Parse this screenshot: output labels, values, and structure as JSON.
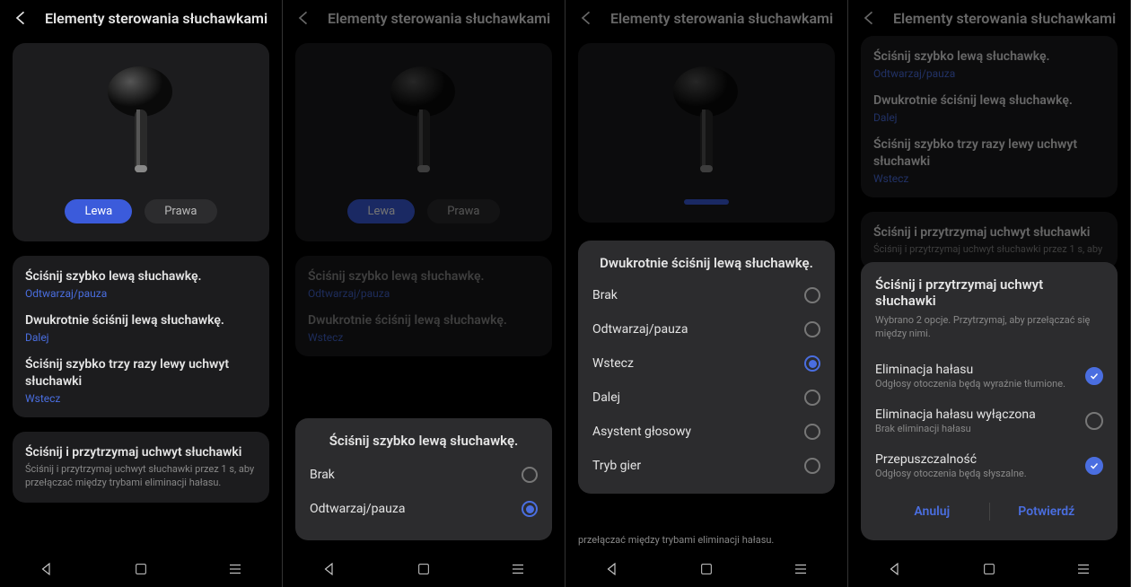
{
  "common": {
    "header_title": "Elementy sterowania słuchawkami",
    "left_pill": "Lewa",
    "right_pill": "Prawa"
  },
  "gestures": {
    "single": {
      "title": "Ściśnij szybko lewą słuchawkę.",
      "value_playpause": "Odtwarzaj/pauza",
      "value_back": "Wstecz"
    },
    "double": {
      "title": "Dwukrotnie ściśnij lewą słuchawkę.",
      "value_next": "Dalej",
      "value_back": "Wstecz"
    },
    "triple": {
      "title": "Ściśnij szybko trzy razy lewy uchwyt słuchawki",
      "value_back": "Wstecz"
    },
    "hold": {
      "title": "Ściśnij i przytrzymaj uchwyt słuchawki",
      "desc": "Ściśnij i przytrzymaj uchwyt słuchawki przez 1 s, aby przełączać między trybami eliminacji hałasu."
    }
  },
  "s2_sheet": {
    "title": "Ściśnij szybko lewą słuchawkę.",
    "opt_none": "Brak",
    "opt_play": "Odtwarzaj/pauza"
  },
  "s3_sheet": {
    "title": "Dwukrotnie ściśnij lewą słuchawkę.",
    "opt_none": "Brak",
    "opt_play": "Odtwarzaj/pauza",
    "opt_back": "Wstecz",
    "opt_next": "Dalej",
    "opt_voice": "Asystent głosowy",
    "opt_game": "Tryb gier"
  },
  "s3_clip": "przełączać między trybami eliminacji hałasu.",
  "s4_hold_sub": "Ściśnij i przytrzymaj uchwyt słuchawki przez 1 s, aby",
  "s4_sheet": {
    "title": "Ściśnij i przytrzymaj uchwyt słuchawki",
    "sub": "Wybrano 2 opcje. Przytrzymaj, aby przełączać się między nimi.",
    "opt_anc": "Eliminacja hałasu",
    "opt_anc_sub": "Odgłosy otoczenia będą wyraźnie tłumione.",
    "opt_off": "Eliminacja hałasu wyłączona",
    "opt_off_sub": "Brak eliminacji hałasu",
    "opt_trans": "Przepuszczalność",
    "opt_trans_sub": "Odgłosy otoczenia będą słyszalne.",
    "btn_cancel": "Anuluj",
    "btn_confirm": "Potwierdź"
  }
}
